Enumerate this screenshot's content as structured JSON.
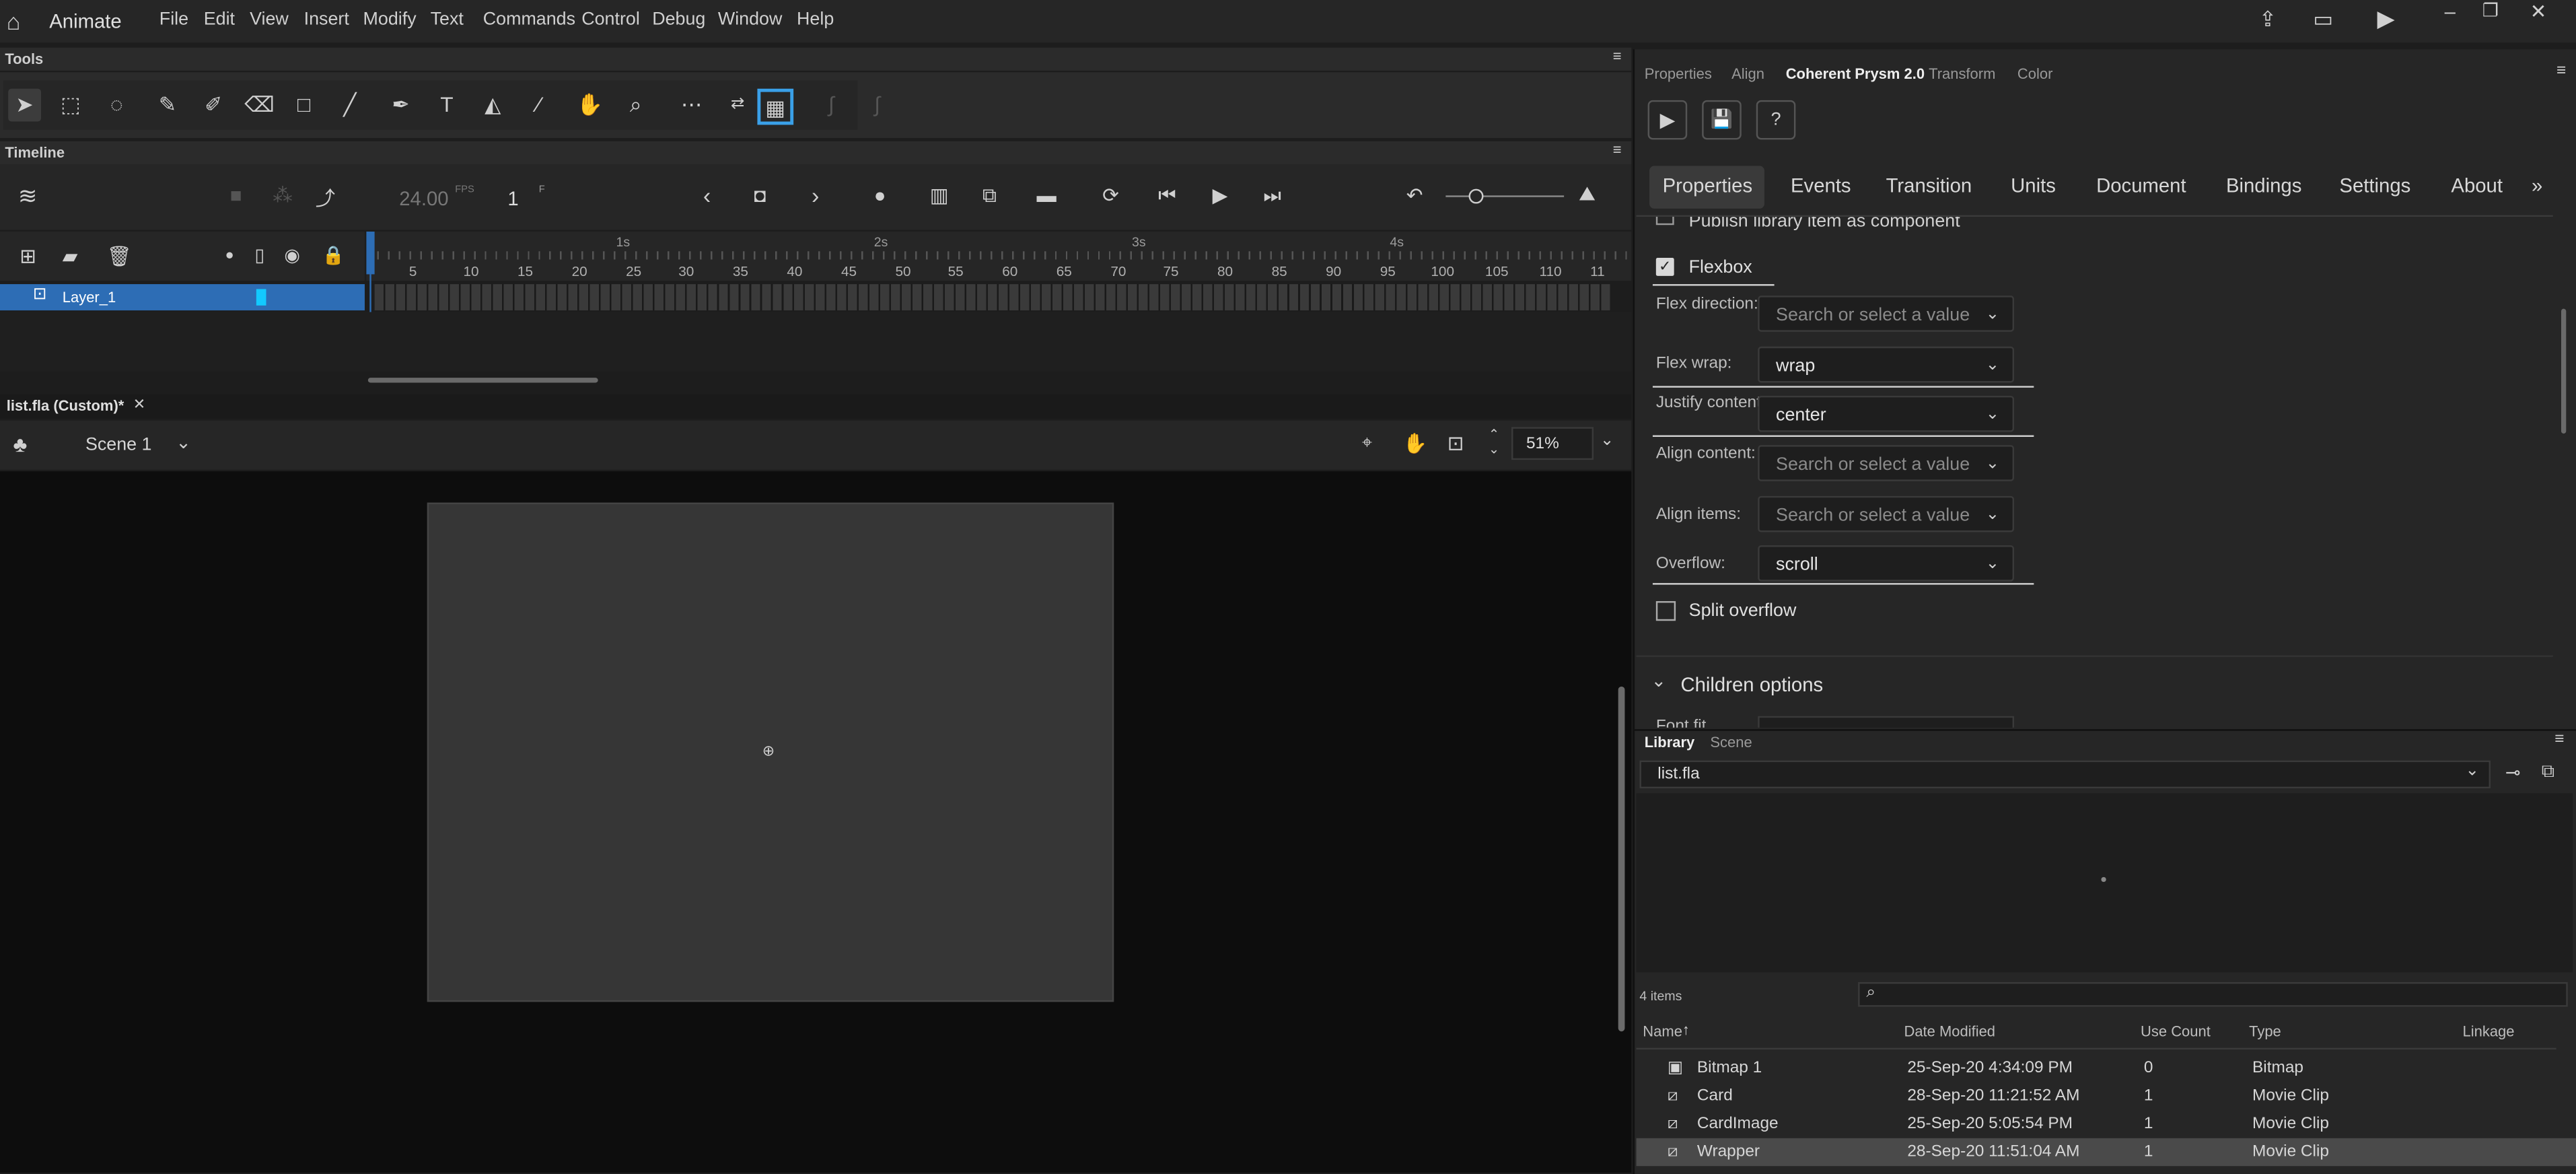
{
  "app": {
    "name": "Animate",
    "menus": [
      "File",
      "Edit",
      "View",
      "Insert",
      "Modify",
      "Text",
      "Commands",
      "Control",
      "Debug",
      "Window",
      "Help"
    ]
  },
  "tools_panel": {
    "title": "Tools"
  },
  "timeline": {
    "title": "Timeline",
    "fps_value": "24.00",
    "fps_unit": "FPS",
    "frame_value": "1",
    "frame_unit": "F",
    "layer_name": "Layer_1",
    "seconds_labels": [
      "1s",
      "2s",
      "3s",
      "4s"
    ],
    "frame_ticks": [
      "5",
      "10",
      "15",
      "20",
      "25",
      "30",
      "35",
      "40",
      "45",
      "50",
      "55",
      "60",
      "65",
      "70",
      "75",
      "80",
      "85",
      "90",
      "95",
      "100",
      "105",
      "110",
      "11"
    ]
  },
  "document": {
    "tab_title": "list.fla (Custom)*",
    "scene": "Scene 1",
    "zoom": "51%"
  },
  "right_panel": {
    "tabs": [
      "Properties",
      "Align",
      "Coherent Prysm 2.0",
      "Transform",
      "Color"
    ],
    "active_tab": "Coherent Prysm 2.0",
    "sub_tabs": [
      "Properties",
      "Events",
      "Transition",
      "Units",
      "Document",
      "Bindings",
      "Settings",
      "About"
    ],
    "more_label": "»",
    "publish_label": "Publish library item as component",
    "flexbox_label": "Flexbox",
    "flexbox_checked": true,
    "fields": [
      {
        "label": "Flex direction:",
        "value": "",
        "placeholder": "Search or select a value"
      },
      {
        "label": "Flex wrap:",
        "value": "wrap",
        "placeholder": ""
      },
      {
        "label": "Justify content:",
        "value": "center",
        "placeholder": ""
      },
      {
        "label": "Align content:",
        "value": "",
        "placeholder": "Search or select a value"
      },
      {
        "label": "Align items:",
        "value": "",
        "placeholder": "Search or select a value"
      },
      {
        "label": "Overflow:",
        "value": "scroll",
        "placeholder": ""
      }
    ],
    "split_overflow_label": "Split overflow",
    "children_options_label": "Children options",
    "font_fit_label": "Font fit"
  },
  "library": {
    "tabs": [
      "Library",
      "Scene"
    ],
    "document": "list.fla",
    "item_count": "4 items",
    "columns": [
      "Name",
      "Date Modified",
      "Use Count",
      "Type",
      "Linkage"
    ],
    "rows": [
      {
        "name": "Bitmap 1",
        "date": "25-Sep-20 4:34:09 PM",
        "use": "0",
        "type": "Bitmap",
        "icon": "bitmap-icon"
      },
      {
        "name": "Card",
        "date": "28-Sep-20 11:21:52 AM",
        "use": "1",
        "type": "Movie Clip",
        "icon": "movieclip-icon"
      },
      {
        "name": "CardImage",
        "date": "25-Sep-20 5:05:54 PM",
        "use": "1",
        "type": "Movie Clip",
        "icon": "movieclip-icon"
      },
      {
        "name": "Wrapper",
        "date": "28-Sep-20 11:51:04 AM",
        "use": "1",
        "type": "Movie Clip",
        "icon": "movieclip-icon",
        "selected": true
      }
    ]
  },
  "colors": {
    "accent": "#2d6db5",
    "layer_swatch": "#13c9ff",
    "stage": "#363636",
    "pasteboard": "#0d0d0d"
  }
}
